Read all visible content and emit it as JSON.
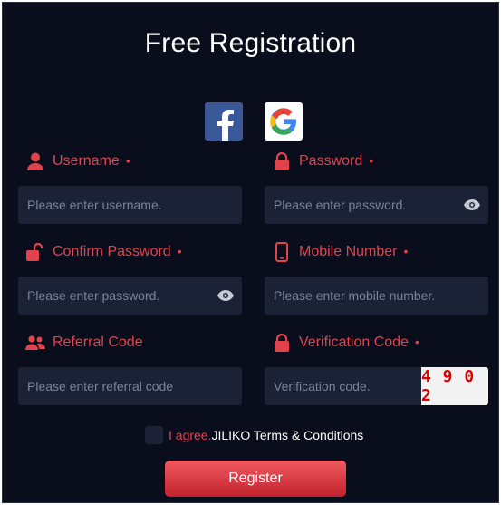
{
  "title": "Free Registration",
  "social": {
    "facebook_icon": "facebook-icon",
    "google_icon": "google-icon"
  },
  "fields": {
    "username": {
      "label": "Username",
      "required_mark": "•",
      "placeholder": "Please enter username.",
      "icon": "user-icon"
    },
    "password": {
      "label": "Password",
      "required_mark": "•",
      "placeholder": "Please enter password.",
      "icon": "lock-icon"
    },
    "confirm_password": {
      "label": "Confirm Password",
      "required_mark": "•",
      "placeholder": "Please enter password.",
      "icon": "unlock-icon"
    },
    "mobile": {
      "label": "Mobile Number",
      "required_mark": "•",
      "placeholder": "Please enter mobile number.",
      "icon": "mobile-phone-icon"
    },
    "referral": {
      "label": "Referral Code",
      "placeholder": "Please enter referral code",
      "icon": "users-icon"
    },
    "verification": {
      "label": "Verification Code",
      "required_mark": "•",
      "placeholder": "Verification code.",
      "icon": "lock-icon",
      "captcha": "4 9 0 2"
    }
  },
  "agree": {
    "prefix": "I agree.",
    "link": "JILIKO Terms & Conditions"
  },
  "register_label": "Register",
  "colors": {
    "background": "#0a0e1c",
    "accent": "#e0434b",
    "input_bg": "#1b2236"
  }
}
